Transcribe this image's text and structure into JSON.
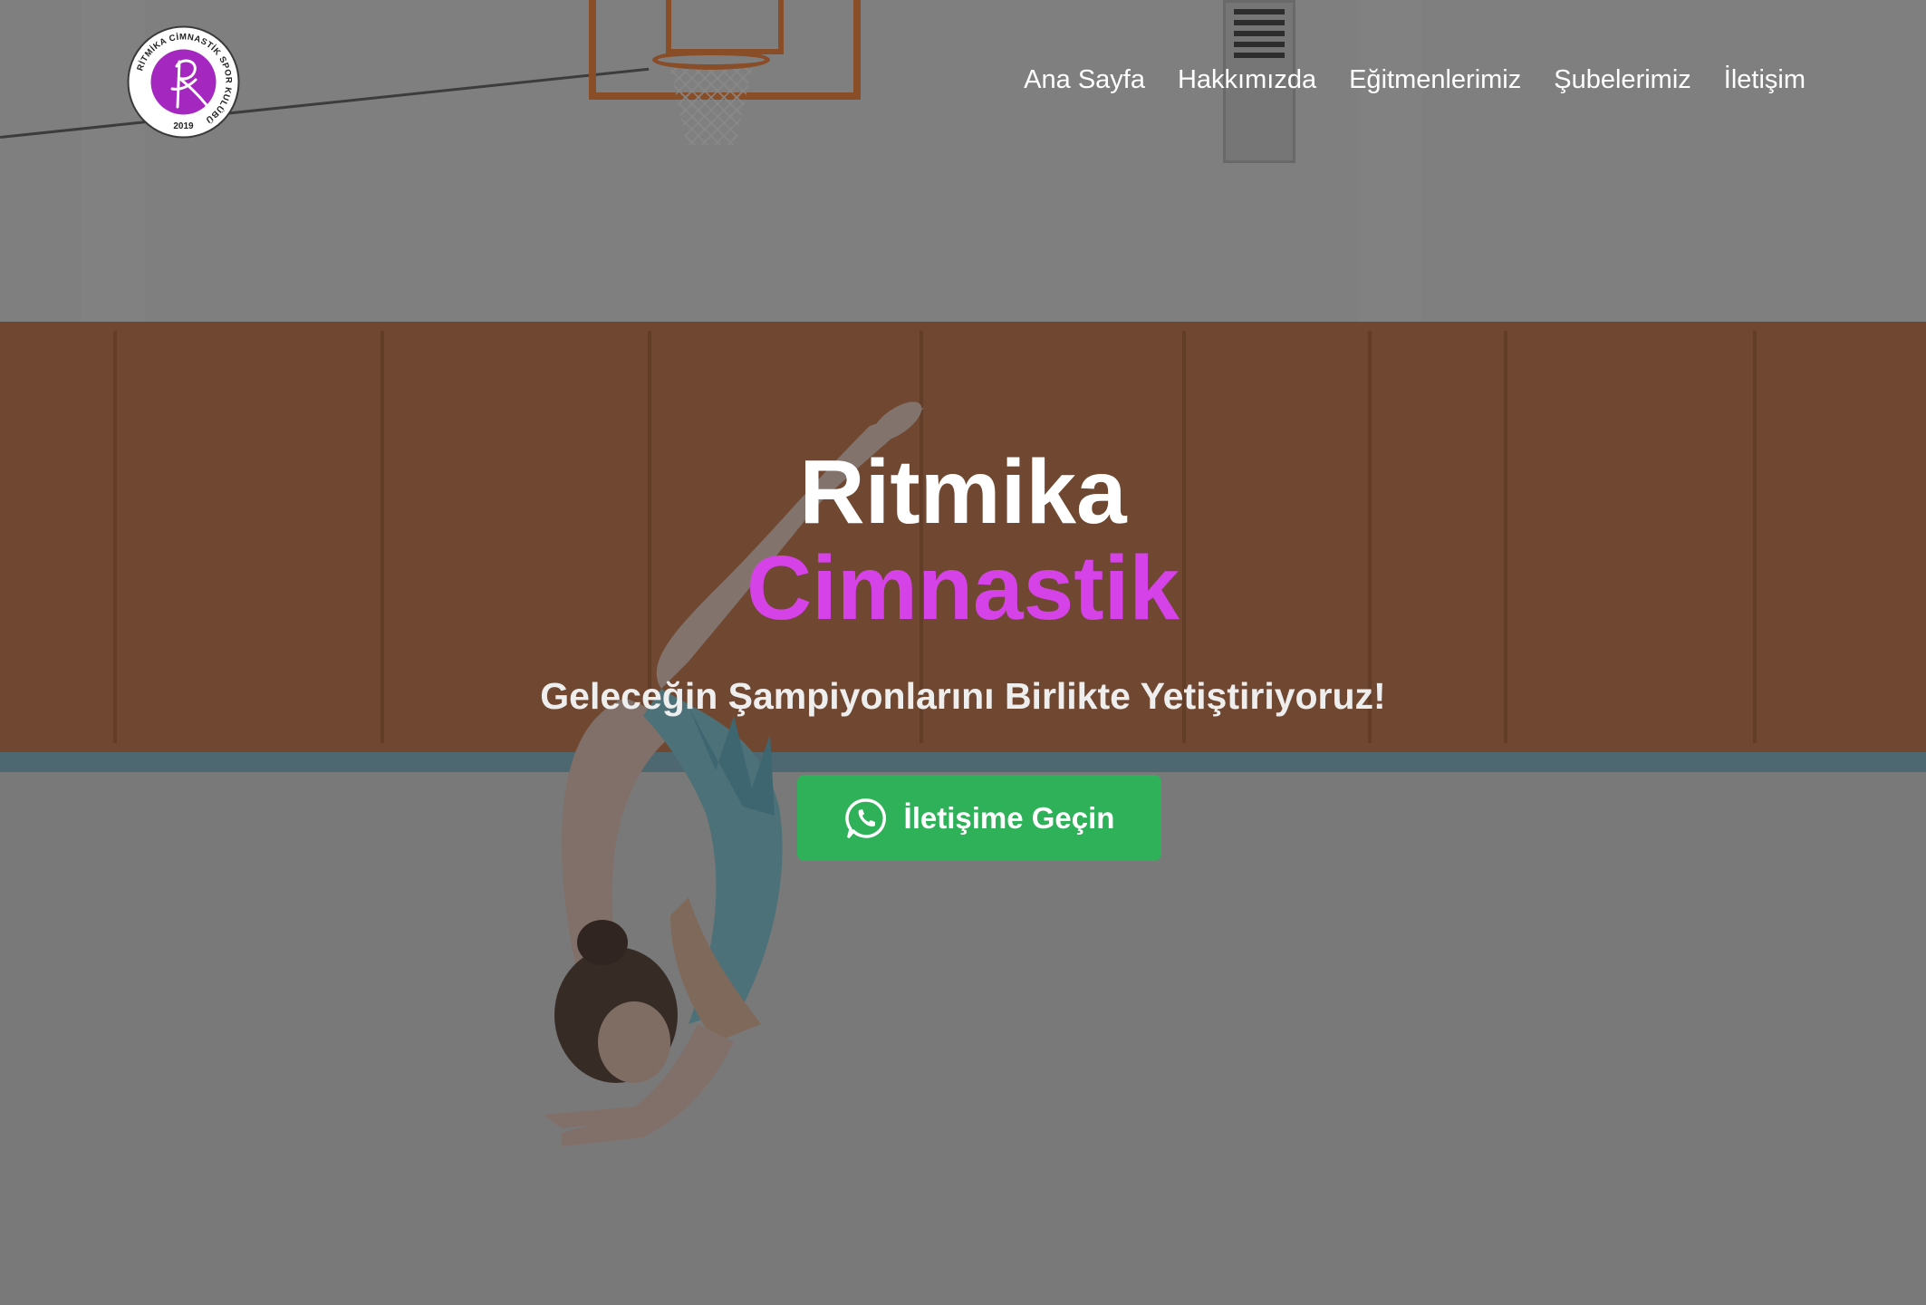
{
  "header": {
    "logo": {
      "ring_text": "RİTMİKA CİMNASTİK SPOR KULÜBÜ",
      "year": "2019",
      "accent": "#a428c0"
    },
    "nav": [
      {
        "label": "Ana Sayfa"
      },
      {
        "label": "Hakkımızda"
      },
      {
        "label": "Eğitmenlerimiz"
      },
      {
        "label": "Şubelerimiz"
      },
      {
        "label": "İletişim"
      }
    ]
  },
  "hero": {
    "title_line1": "Ritmika",
    "title_line2": "Cimnastik",
    "subtitle": "Geleceğin Şampiyonlarını Birlikte Yetiştiriyoruz!",
    "cta": {
      "label": "İletişime Geçin",
      "icon": "whatsapp-icon",
      "color": "#2fb15a"
    },
    "accent_color": "#d542e8"
  }
}
